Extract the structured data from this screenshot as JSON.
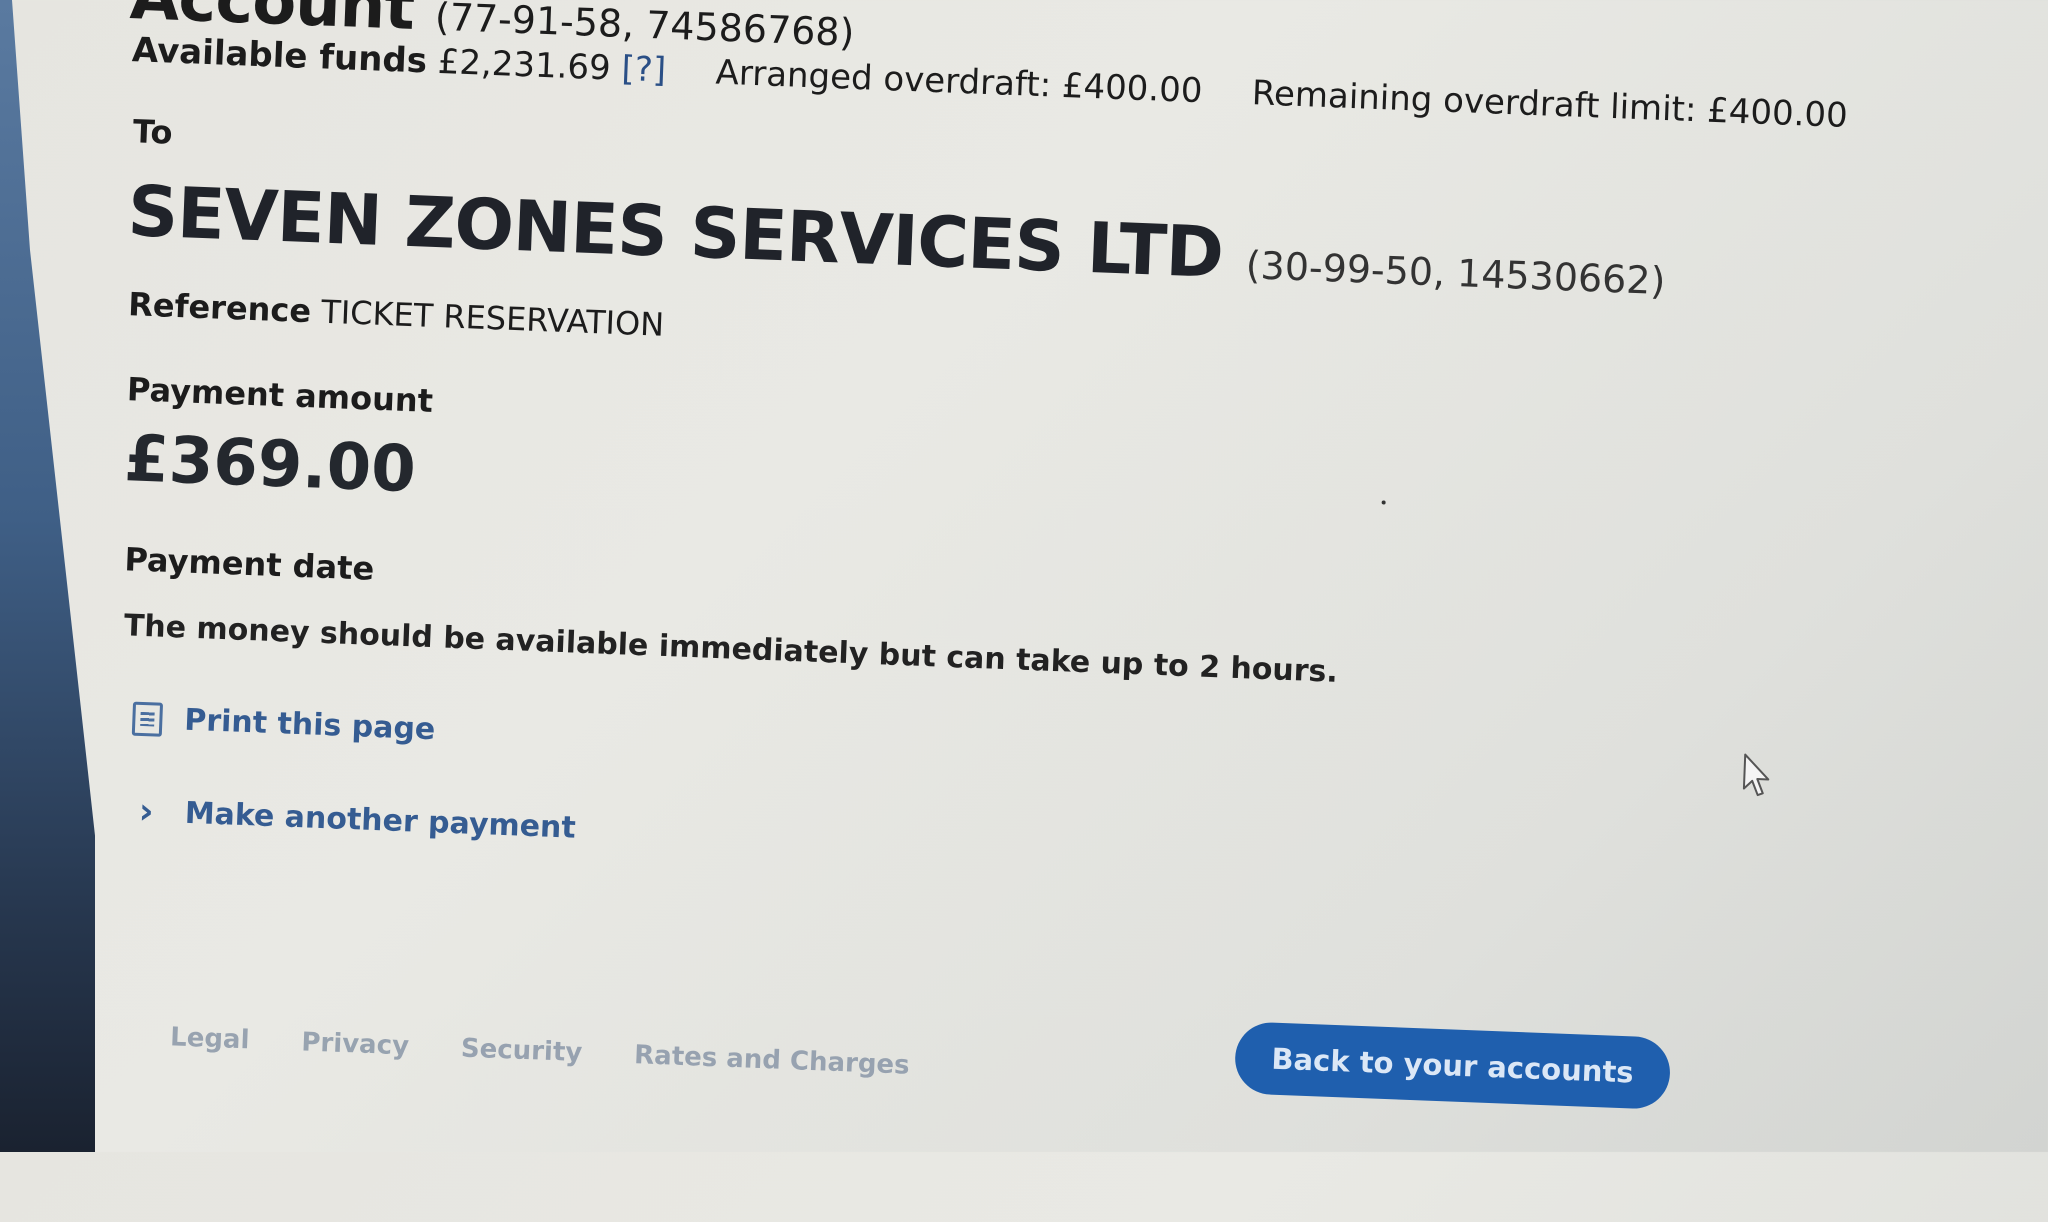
{
  "account": {
    "heading": "Account",
    "number": "(77-91-58, 74586768)"
  },
  "funds": {
    "available_label": "Available funds",
    "available_value": "£2,231.69",
    "help": "[?]",
    "arranged_overdraft": "Arranged overdraft: £400.00",
    "remaining_overdraft": "Remaining overdraft limit: £400.00"
  },
  "payee": {
    "to_label": "To",
    "name": "SEVEN ZONES SERVICES LTD",
    "account": "(30-99-50, 14530662)",
    "reference_label": "Reference",
    "reference_value": "TICKET RESERVATION"
  },
  "payment": {
    "amount_label": "Payment amount",
    "amount_value": "£369.00",
    "date_label": "Payment date",
    "info": "The money should be available immediately but can take up to 2 hours."
  },
  "links": {
    "print": "Print this page",
    "another": "Make another payment"
  },
  "buttons": {
    "back": "Back to your accounts"
  },
  "footer": [
    "Legal",
    "Privacy",
    "Security",
    "Rates and Charges"
  ],
  "icons": {
    "print": "print-page-icon",
    "chevron": "chevron-right-icon",
    "cursor": "mouse-pointer-icon"
  },
  "colors": {
    "accent": "#1f5fae",
    "link": "#355c92",
    "background": "#e6e5e0"
  }
}
